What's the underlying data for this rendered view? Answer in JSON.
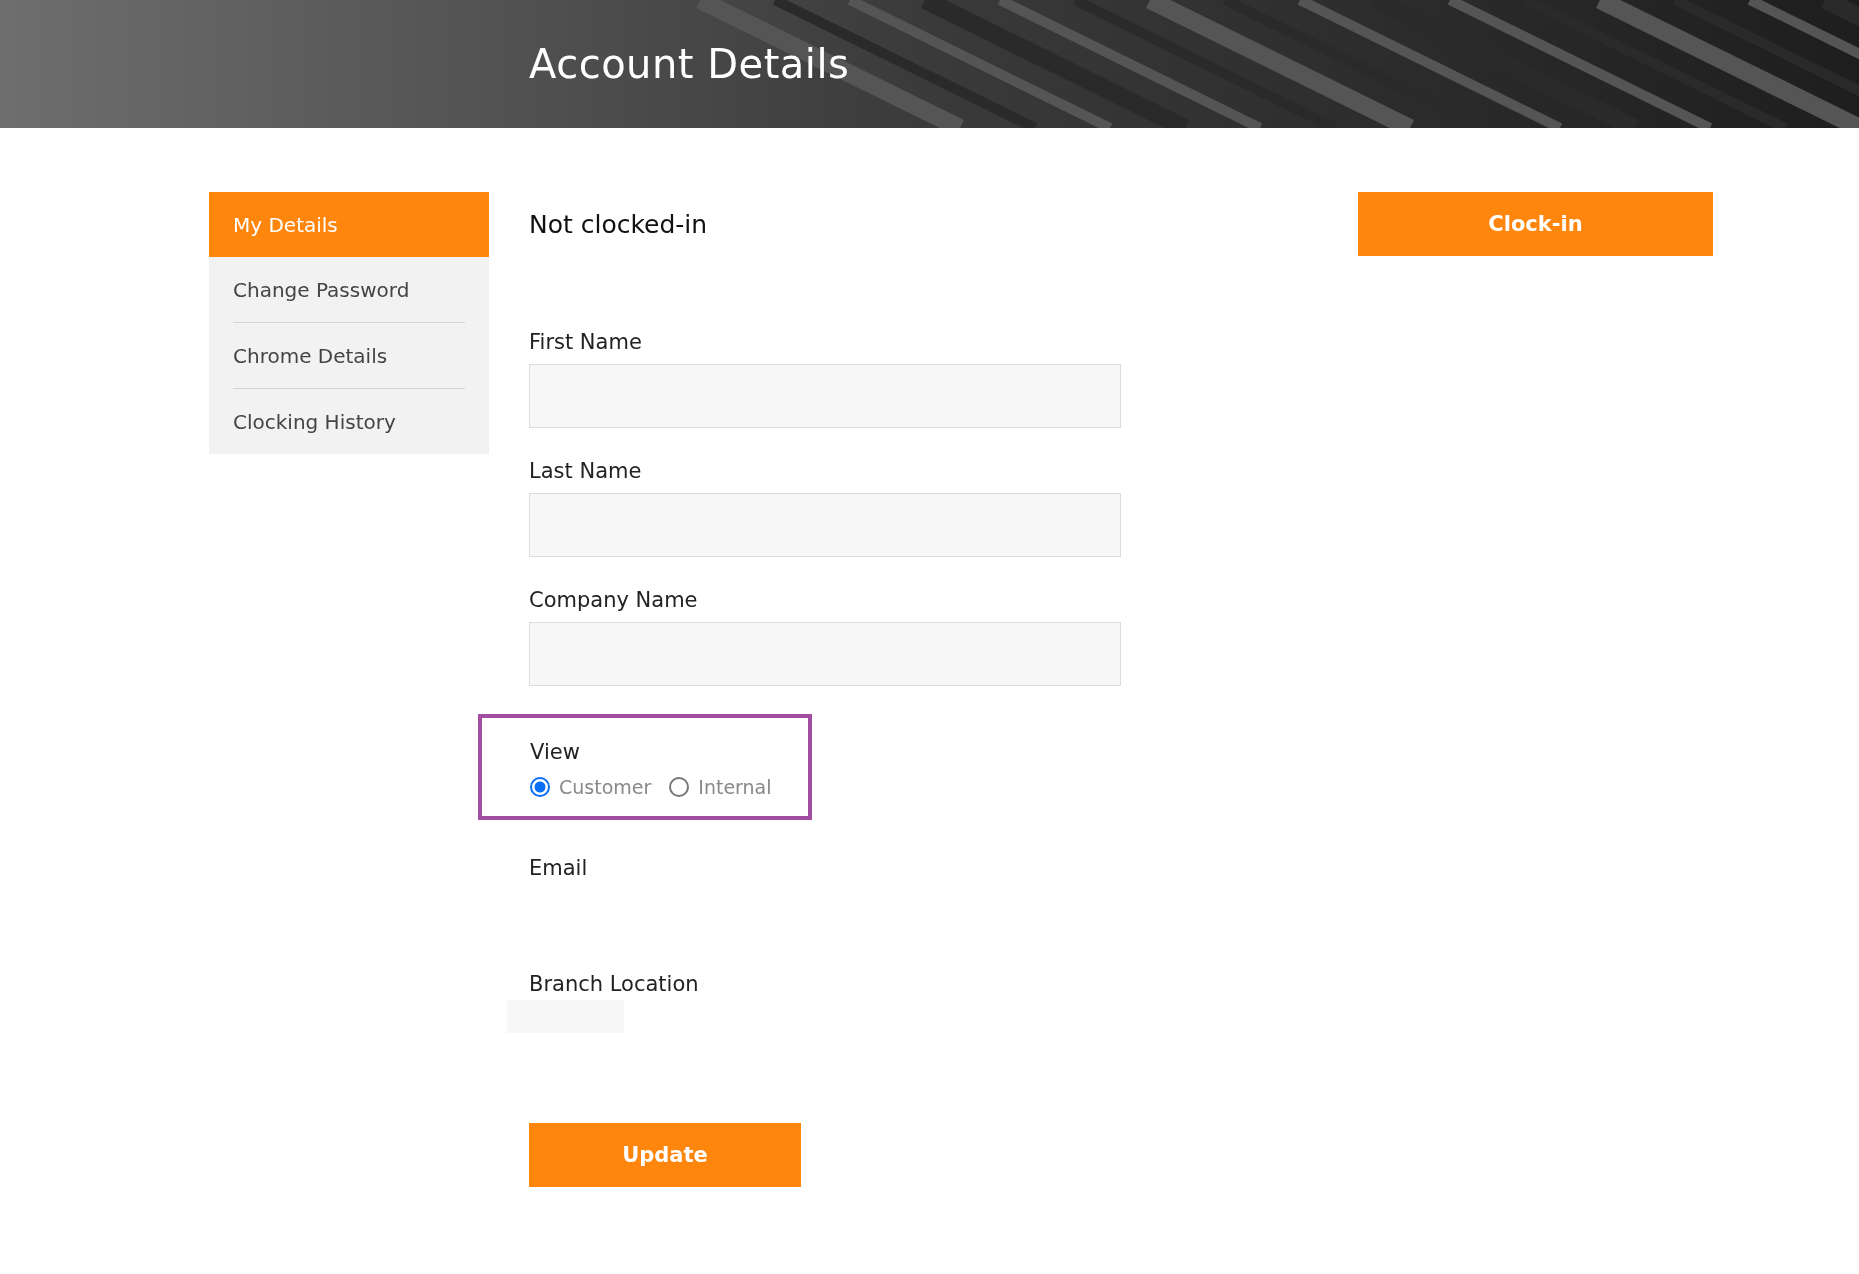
{
  "header": {
    "title": "Account Details"
  },
  "sidebar": {
    "items": [
      {
        "label": "My Details",
        "selected": true
      },
      {
        "label": "Change Password",
        "selected": false
      },
      {
        "label": "Chrome Details",
        "selected": false
      },
      {
        "label": "Clocking History",
        "selected": false
      }
    ]
  },
  "status": "Not clocked-in",
  "clock_button": "Clock-in",
  "fields": [
    {
      "label": "First Name"
    },
    {
      "label": "Last Name"
    },
    {
      "label": "Company Name"
    }
  ],
  "view": {
    "label": "View",
    "highlighted": true,
    "options": [
      {
        "label": "Customer",
        "selected": true
      },
      {
        "label": "Internal",
        "selected": false
      }
    ]
  },
  "email": {
    "label": "Email"
  },
  "branch": {
    "label": "Branch Location"
  },
  "update_button": "Update"
}
